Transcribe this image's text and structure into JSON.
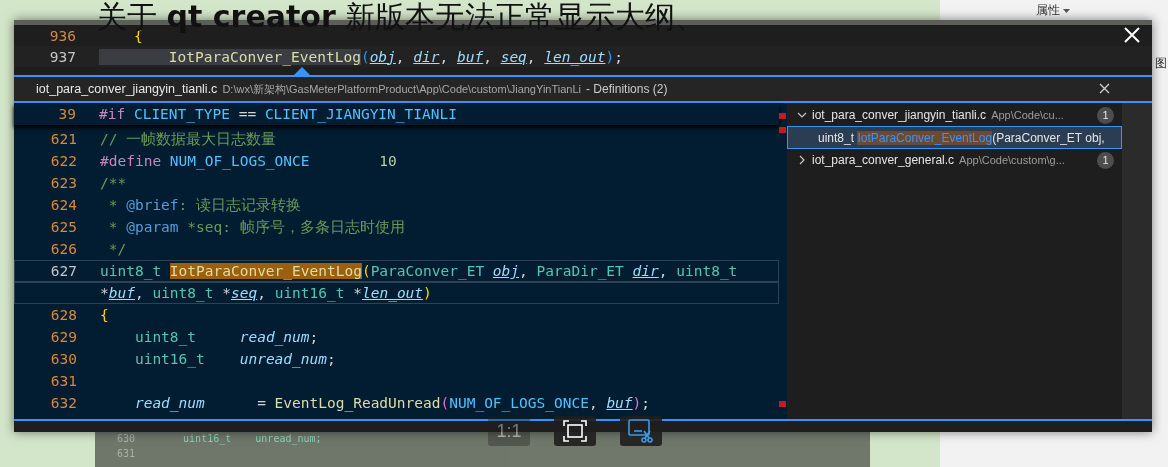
{
  "page": {
    "heading": "关于 **qt creator** 新版本无法正常显示大纲、",
    "panel_label": "属性",
    "panel_label_2": "图",
    "background_code": [
      {
        "line": "630",
        "code": "    uint16_t    unread_num;"
      },
      {
        "line": "631"
      }
    ]
  },
  "viewer": {
    "toolbar": [
      {
        "kind": "text",
        "label": "1:1",
        "disabled": true
      },
      {
        "kind": "fit",
        "disabled": false
      },
      {
        "kind": "crop",
        "disabled": false
      }
    ],
    "editor": {
      "lines": [
        {
          "line": "936",
          "current": false,
          "tokens": [
            {
              "text": "    {",
              "kind": "brace"
            }
          ]
        },
        {
          "line": "937",
          "current": true,
          "tokens": [
            {
              "text": "        IotParaConver_EventLog",
              "kind": "ref"
            },
            {
              "text": "(",
              "kind": "paren2"
            },
            {
              "text": "obj",
              "kind": "param"
            },
            {
              "text": ", ",
              "kind": "plain"
            },
            {
              "text": "dir",
              "kind": "param"
            },
            {
              "text": ", ",
              "kind": "plain"
            },
            {
              "text": "buf",
              "kind": "param"
            },
            {
              "text": ", ",
              "kind": "plain"
            },
            {
              "text": "seq",
              "kind": "param"
            },
            {
              "text": ", ",
              "kind": "plain"
            },
            {
              "text": "len_out",
              "kind": "param"
            },
            {
              "text": ")",
              "kind": "paren2"
            },
            {
              "text": ";",
              "kind": "plain"
            }
          ]
        }
      ],
      "peek": {
        "file": "iot_para_conver_jiangyin_tianli.c",
        "path": "D:\\wx\\新架构\\GasMeterPlatformProduct\\App\\Code\\custom\\JiangYinTianLi",
        "title": "- Definitions (2)",
        "sticky": {
          "line": "39",
          "current": false,
          "tokens": [
            {
              "text": "#if ",
              "kind": "kw"
            },
            {
              "text": "CLIENT_TYPE",
              "kind": "macro"
            },
            {
              "text": " == ",
              "kind": "plain"
            },
            {
              "text": "CLIENT_JIANGYIN_TIANLI",
              "kind": "macro"
            }
          ]
        },
        "lines": [
          {
            "line": "621",
            "current": false,
            "tokens": [
              {
                "text": "// 一帧数据最大日志数量",
                "kind": "comment"
              }
            ]
          },
          {
            "line": "622",
            "current": false,
            "tokens": [
              {
                "text": "#define ",
                "kind": "kw"
              },
              {
                "text": "NUM_OF_LOGS_ONCE",
                "kind": "macro"
              },
              {
                "text": "        10",
                "kind": "num"
              }
            ]
          },
          {
            "line": "623",
            "current": false,
            "tokens": [
              {
                "text": "/**",
                "kind": "comment"
              }
            ]
          },
          {
            "line": "624",
            "current": false,
            "tokens": [
              {
                "text": " * ",
                "kind": "comment"
              },
              {
                "text": "@brief",
                "kind": "doc"
              },
              {
                "text": ": 读日志记录转换",
                "kind": "comment"
              }
            ]
          },
          {
            "line": "625",
            "current": false,
            "tokens": [
              {
                "text": " * ",
                "kind": "comment"
              },
              {
                "text": "@param",
                "kind": "doc"
              },
              {
                "text": " *seq: 帧序号，多条日志时使用",
                "kind": "comment"
              }
            ]
          },
          {
            "line": "626",
            "current": false,
            "tokens": [
              {
                "text": " */",
                "kind": "comment"
              }
            ]
          },
          {
            "line": "627",
            "current": true,
            "tokens": [
              {
                "text": "uint8_t ",
                "kind": "type"
              },
              {
                "text": "IotParaConver_EventLog",
                "kind": "match"
              },
              {
                "text": "(",
                "kind": "brace"
              },
              {
                "text": "ParaConver_ET ",
                "kind": "type"
              },
              {
                "text": "obj",
                "kind": "param"
              },
              {
                "text": ", ",
                "kind": "plain"
              },
              {
                "text": "ParaDir_ET ",
                "kind": "type"
              },
              {
                "text": "dir",
                "kind": "param"
              },
              {
                "text": ", ",
                "kind": "plain"
              },
              {
                "text": "uint8_t",
                "kind": "type"
              }
            ]
          },
          {
            "current": true,
            "tokens": [
              {
                "text": "*",
                "kind": "plain"
              },
              {
                "text": "buf",
                "kind": "param"
              },
              {
                "text": ", ",
                "kind": "plain"
              },
              {
                "text": "uint8_t",
                "kind": "type"
              },
              {
                "text": " *",
                "kind": "plain"
              },
              {
                "text": "seq",
                "kind": "param"
              },
              {
                "text": ", ",
                "kind": "plain"
              },
              {
                "text": "uint16_t",
                "kind": "type"
              },
              {
                "text": " *",
                "kind": "plain"
              },
              {
                "text": "len_out",
                "kind": "param"
              },
              {
                "text": ")",
                "kind": "brace"
              }
            ]
          },
          {
            "line": "628",
            "current": false,
            "tokens": [
              {
                "text": "{",
                "kind": "brace"
              }
            ]
          },
          {
            "line": "629",
            "current": false,
            "tokens": [
              {
                "text": "    uint8_t     ",
                "kind": "type"
              },
              {
                "text": "read_num",
                "kind": "var"
              },
              {
                "text": ";",
                "kind": "plain"
              }
            ]
          },
          {
            "line": "630",
            "current": false,
            "tokens": [
              {
                "text": "    uint16_t    ",
                "kind": "type"
              },
              {
                "text": "unread_num",
                "kind": "var"
              },
              {
                "text": ";",
                "kind": "plain"
              }
            ]
          },
          {
            "line": "631",
            "current": false
          },
          {
            "line": "632",
            "current": false,
            "tokens": [
              {
                "text": "    read_num",
                "kind": "var"
              },
              {
                "text": "      = ",
                "kind": "plain"
              },
              {
                "text": "EventLog_ReadUnread",
                "kind": "fn"
              },
              {
                "text": "(",
                "kind": "paren"
              },
              {
                "text": "NUM_OF_LOGS_ONCE",
                "kind": "macro"
              },
              {
                "text": ", ",
                "kind": "plain"
              },
              {
                "text": "buf",
                "kind": "param"
              },
              {
                "text": ")",
                "kind": "paren"
              },
              {
                "text": ";",
                "kind": "plain"
              }
            ]
          }
        ],
        "references": [
          {
            "file": "iot_para_conver_jiangyin_tianli.c",
            "path": "App\\Code\\cu...",
            "count": "1",
            "expanded": true,
            "children": [
              {
                "prefix": "uint8_t ",
                "match": "IotParaConver_EventLog",
                "rest": "(ParaConver_ET obj,",
                "selected": true
              }
            ]
          },
          {
            "file": "iot_para_conver_general.c",
            "path": "App\\Code\\custom\\g...",
            "count": "1",
            "expanded": false
          }
        ]
      }
    }
  }
}
